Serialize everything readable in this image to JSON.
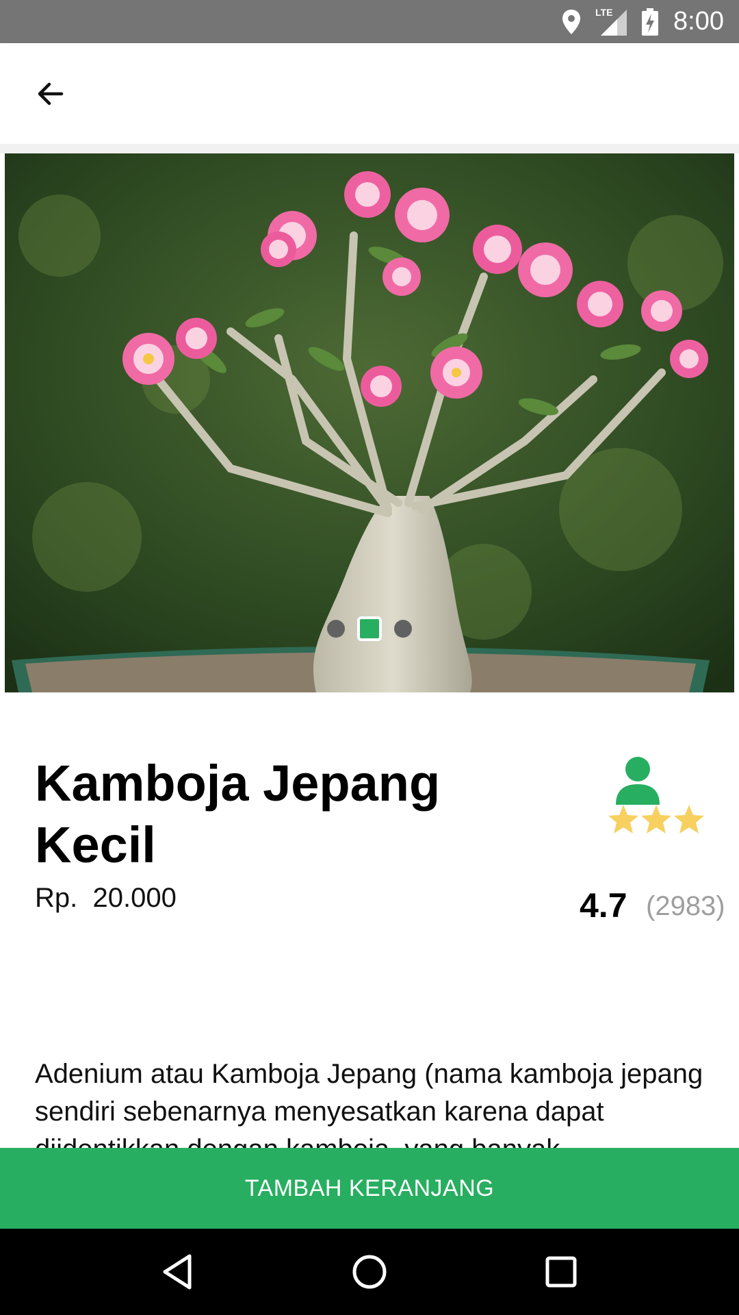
{
  "status_bar": {
    "time": "8:00",
    "icons": [
      "location-icon",
      "lte-signal-icon",
      "battery-charging-icon"
    ],
    "network_label": "LTE"
  },
  "app_bar": {
    "back_icon": "arrow-left-icon"
  },
  "carousel": {
    "slide_count": 3,
    "active_index": 1,
    "image_subject": "adenium-plant-photo"
  },
  "product": {
    "title": "Kamboja Jepang Kecil",
    "price": "Rp.  20.000",
    "rating": "4.7",
    "rating_count": "(2983)",
    "rating_stars": 3,
    "seller_icon": "person-icon",
    "description": "Adenium atau Kamboja Jepang (nama kamboja jepang sendiri sebenarnya menyesatkan karena dapat diidentikkan dengan kamboja, yang banyak"
  },
  "actions": {
    "add_to_cart": "TAMBAH KERANJANG"
  },
  "nav_bar": {
    "icons": [
      "back-triangle-icon",
      "home-circle-icon",
      "recents-square-icon"
    ]
  },
  "colors": {
    "accent": "#27ae60",
    "status_bar": "#757575",
    "star": "#f7d060",
    "muted": "#9e9e9e"
  }
}
